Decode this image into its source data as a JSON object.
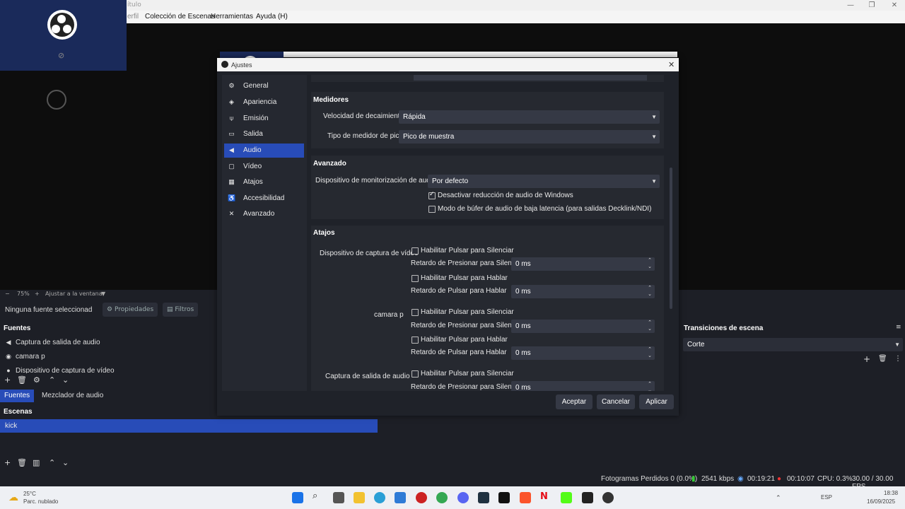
{
  "window": {
    "title": "ítulo",
    "controls": [
      "—",
      "❐",
      "✕"
    ]
  },
  "menu": [
    "erfil",
    "Colección de Escenas",
    "Herramientas",
    "Ayuda (H)"
  ],
  "zoom": {
    "minus": "−",
    "value": "75%",
    "plus": "+",
    "fit": "Ajustar a la ventana"
  },
  "source_bar": {
    "none": "Ninguna fuente seleccionad",
    "props": "Propiedades",
    "filters": "Filtros"
  },
  "sources": {
    "title": "Fuentes",
    "items": [
      {
        "icon": "speaker-icon",
        "label": "Captura de salida de audio"
      },
      {
        "icon": "camera-icon",
        "label": "camara p"
      },
      {
        "icon": "mic-icon",
        "label": "Dispositivo de captura de vídeo"
      }
    ]
  },
  "tabs": [
    "Fuentes",
    "Mezclador de audio"
  ],
  "scenes": {
    "title": "Escenas",
    "items": [
      "kick"
    ]
  },
  "transitions": {
    "title": "Transiciones de escena",
    "selected": "Corte"
  },
  "status": {
    "dropped": "Fotogramas Perdidos 0 (0.0%)",
    "kbps": "2541 kbps",
    "stream_time": "00:19:21",
    "rec_time": "00:10:07",
    "cpu": "CPU: 0.3%",
    "fps": "30.00 / 30.00 FPS"
  },
  "taskbar": {
    "weather_temp": "25°C",
    "weather_desc": "Parc. nublado",
    "lang": "ESP",
    "time": "18:38",
    "date": "16/09/2025"
  },
  "dialog": {
    "title": "Ajustes",
    "close": "✕",
    "sidebar": [
      {
        "icon": "gear-icon",
        "label": "General"
      },
      {
        "icon": "palette-icon",
        "label": "Apariencia"
      },
      {
        "icon": "antenna-icon",
        "label": "Emisión"
      },
      {
        "icon": "output-icon",
        "label": "Salida"
      },
      {
        "icon": "speaker-icon",
        "label": "Audio",
        "active": true
      },
      {
        "icon": "monitor-icon",
        "label": "Vídeo"
      },
      {
        "icon": "keyboard-icon",
        "label": "Atajos"
      },
      {
        "icon": "accessibility-icon",
        "label": "Accesibilidad"
      },
      {
        "icon": "tools-icon",
        "label": "Avanzado"
      }
    ],
    "medidores": {
      "title": "Medidores",
      "decay_label": "Velocidad de decaimiento",
      "decay_value": "Rápida",
      "peak_label": "Tipo de medidor de pico",
      "peak_value": "Pico de muestra"
    },
    "avanzado": {
      "title": "Avanzado",
      "monitor_label": "Dispositivo de monitorización de audio",
      "monitor_value": "Por defecto",
      "ducking_label": "Desactivar reducción de audio de Windows",
      "ducking_checked": true,
      "lowlat_label": "Modo de búfer de audio de baja latencia (para salidas Decklink/NDI)",
      "lowlat_checked": false
    },
    "atajos": {
      "title": "Atajos",
      "devices": [
        {
          "name": "Dispositivo de captura de vídeo",
          "ptm": "Habilitar Pulsar para Silenciar",
          "ptm_delay_label": "Retardo de Presionar para Silenciar",
          "ptm_delay": "0 ms",
          "ptt": "Habilitar Pulsar para Hablar",
          "ptt_delay_label": "Retardo de Pulsar para Hablar",
          "ptt_delay": "0 ms"
        },
        {
          "name": "camara p",
          "ptm": "Habilitar Pulsar para Silenciar",
          "ptm_delay_label": "Retardo de Presionar para Silenciar",
          "ptm_delay": "0 ms",
          "ptt": "Habilitar Pulsar para Hablar",
          "ptt_delay_label": "Retardo de Pulsar para Hablar",
          "ptt_delay": "0 ms"
        },
        {
          "name": "Captura de salida de audio",
          "ptm": "Habilitar Pulsar para Silenciar",
          "ptm_delay_label": "Retardo de Presionar para Silenciar",
          "ptm_delay": "0 ms"
        }
      ]
    },
    "buttons": {
      "accept": "Aceptar",
      "cancel": "Cancelar",
      "apply": "Aplicar"
    }
  }
}
